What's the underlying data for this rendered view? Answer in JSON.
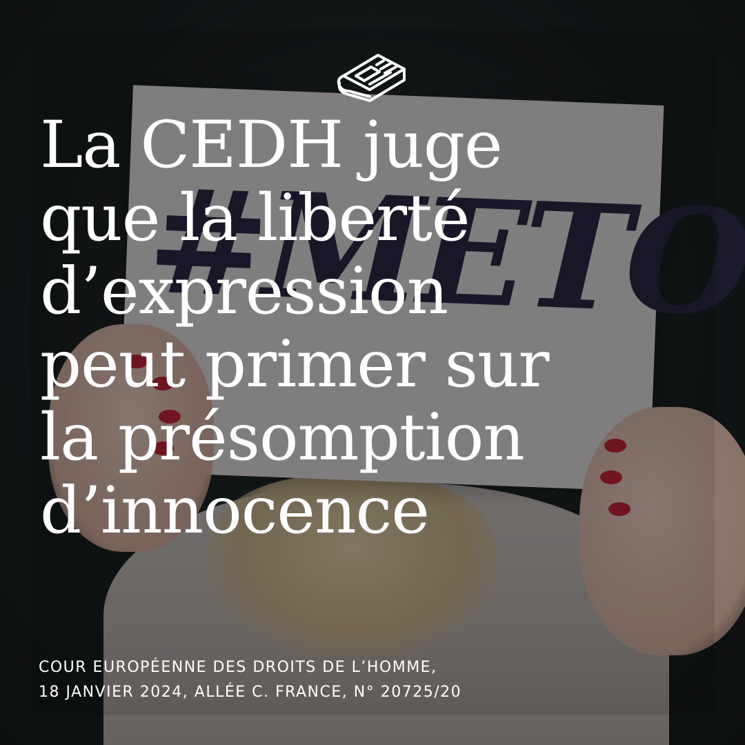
{
  "icon": "newspaper-icon",
  "colors": {
    "text": "#ffffff",
    "nail_polish": "#c8283a",
    "sign_ink": "#2c2b4a"
  },
  "sign_text": "#METOO",
  "headline": {
    "lines": [
      "La CEDH juge",
      "que la liberté",
      "d’expression",
      "peut primer sur",
      "la présomption",
      "d’innocence"
    ]
  },
  "citation": {
    "lines": [
      "COUR EUROPÉENNE DES DROITS DE L’HOMME,",
      "18 JANVIER 2024, ALLÉE C. FRANCE, N° 20725/20"
    ]
  }
}
